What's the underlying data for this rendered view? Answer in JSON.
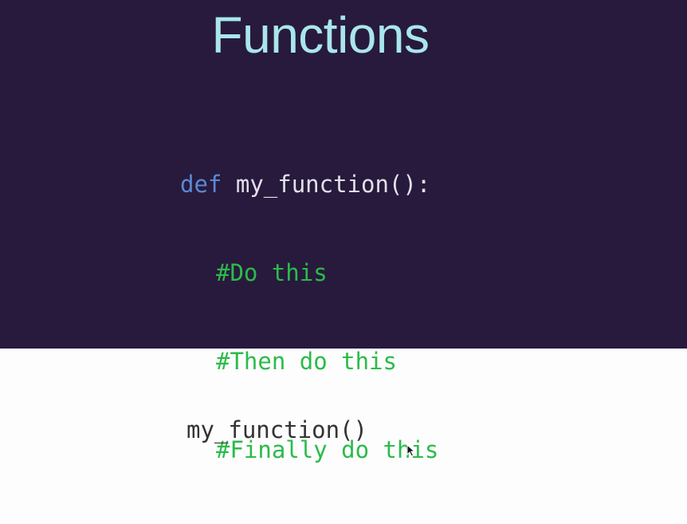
{
  "slide": {
    "title": "Functions",
    "code": {
      "keyword": "def",
      "signature": "my_function():",
      "comments": [
        "#Do this",
        "#Then do this",
        "#Finally do this"
      ]
    },
    "colors": {
      "background": "#281a3c",
      "title": "#a9e6ec",
      "keyword": "#5b88d6",
      "function": "#e2e0ea",
      "comment": "#2bbb4b"
    }
  },
  "bottom": {
    "call": "my_function()"
  },
  "cursor": {
    "icon": "mouse-pointer-icon"
  }
}
